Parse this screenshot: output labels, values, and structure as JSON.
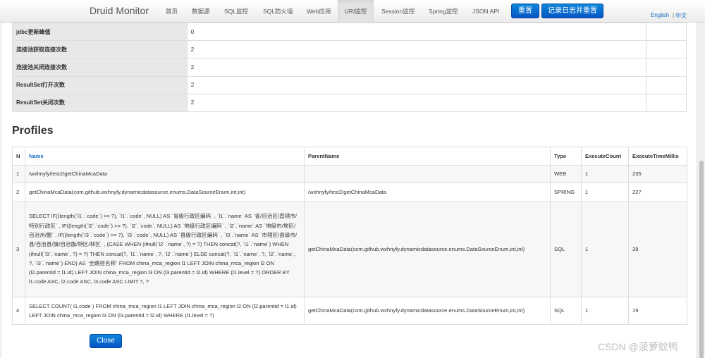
{
  "nav": {
    "brand": "Druid Monitor",
    "items": [
      "首页",
      "数据源",
      "SQL监控",
      "SQL防火墙",
      "Web应用",
      "URI监控",
      "Session监控",
      "Spring监控",
      "JSON API"
    ],
    "reset_label": "重置",
    "log_reset_label": "记录日志并重置",
    "lang_en": "English",
    "lang_sep": "|",
    "lang_zh": "中文"
  },
  "stats": [
    {
      "label": "jdbc更新峰值",
      "value": "0"
    },
    {
      "label": "连接池获取连接次数",
      "value": "2"
    },
    {
      "label": "连接池关闭连接次数",
      "value": "2"
    },
    {
      "label": "ResultSet打开次数",
      "value": "2"
    },
    {
      "label": "ResultSet关闭次数",
      "value": "2"
    }
  ],
  "profiles": {
    "title": "Profiles",
    "headers": {
      "n": "N",
      "name": "Name",
      "parent": "ParentName",
      "type": "Type",
      "count": "ExecuteCount",
      "millis": "ExecuteTimeMillis"
    },
    "rows": [
      {
        "n": "1",
        "name": "/wxhnyfy/test2/getChinaMcaData",
        "parent": "",
        "type": "WEB",
        "count": "1",
        "millis": "235"
      },
      {
        "n": "2",
        "name": "getChinaMcaData(com.github.wxhnyfy.dynamicdatasource.enums.DataSourceEnum,int,int)",
        "parent": "/wxhnyfy/test2/getChinaMcaData",
        "type": "SPRING",
        "count": "1",
        "millis": "227"
      },
      {
        "n": "3",
        "name": "SELECT IF((length(`l1`.`code`) >= ?), `l1`.`code`, NULL) AS `省级行政区编码` , `l1`.`name` AS `省/自治区/直辖市/特别行政区` , IF((length(`l2`.`code`) >= ?), `l2`.`code`, NULL) AS `地级行政区编码` , `l2`.`name` AS `地级市/地区/自治州/盟` , IF((length(`l3`.`code`) >= ?), `l3`.`code`, NULL) AS `县级行政区编码` , `l3`.`name` AS `市辖区/县级市/县/自治县/旗/自治旗/特区/林区` , (CASE WHEN (ifnull(`l2`.`name`, ?) = ?) THEN concat(?, `l1`.`name`) WHEN (ifnull(`l3`.`name`, ?) = ?) THEN concat(?, `l1`.`name`, ?, `l2`.`name`) ELSE concat(?, `l1`.`name`, ?, `l2`.`name`, ?, `l3`.`name`) END) AS `全路径名称` FROM china_mca_region l1 LEFT JOIN china_mca_region l2 ON (l2.parentid = l1.id) LEFT JOIN china_mca_region l3 ON (l3.parentid = l2.id) WHERE (l1.level = ?) ORDER BY l1.code ASC, l2.code ASC, l3.code ASC LIMIT ?, ?",
        "parent": "getChinaMcaData(com.github.wxhnyfy.dynamicdatasource.enums.DataSourceEnum,int,int)",
        "type": "SQL",
        "count": "1",
        "millis": "39"
      },
      {
        "n": "4",
        "name": "SELECT COUNT( l1.code ) FROM china_mca_region l1 LEFT JOIN china_mca_region l2 ON (l2.parentid = l1.id) LEFT JOIN china_mca_region l3 ON (l3.parentid = l2.id) WHERE (l1.level = ?)",
        "parent": "getChinaMcaData(com.github.wxhnyfy.dynamicdatasource.enums.DataSourceEnum,int,int)",
        "type": "SQL",
        "count": "1",
        "millis": "19"
      }
    ]
  },
  "close_label": "Close",
  "watermark": "CSDN @菠萝蚊鸭",
  "colors": {
    "accent": "#0a6ed1",
    "link": "#1a6fc9",
    "label_bg": "#e8e8e8"
  }
}
